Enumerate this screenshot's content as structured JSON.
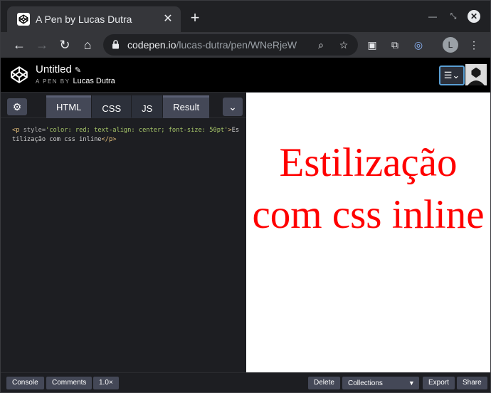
{
  "browser": {
    "tab_title": "A Pen by Lucas Dutra",
    "url_domain": "codepen.io",
    "url_path": "/lucas-dutra/pen/WNeRjeW",
    "profile_initial": "L"
  },
  "pen": {
    "title": "Untitled",
    "by_label": "A PEN BY",
    "author": "Lucas Dutra"
  },
  "editor": {
    "tabs": [
      "HTML",
      "CSS",
      "JS",
      "Result"
    ],
    "active_tab": "HTML",
    "code": {
      "open_tag": "<p",
      "attr": " style=",
      "value": "'color: red; text-align: center; font-size: 50pt'",
      "close_bracket": ">",
      "text": "Estilização com css inline",
      "end_tag": "</p>"
    }
  },
  "preview": {
    "text": "Estilização com css inline",
    "color": "#ff0000"
  },
  "footer": {
    "console": "Console",
    "comments": "Comments",
    "zoom": "1.0×",
    "delete": "Delete",
    "collections": "Collections",
    "export": "Export",
    "share": "Share"
  }
}
